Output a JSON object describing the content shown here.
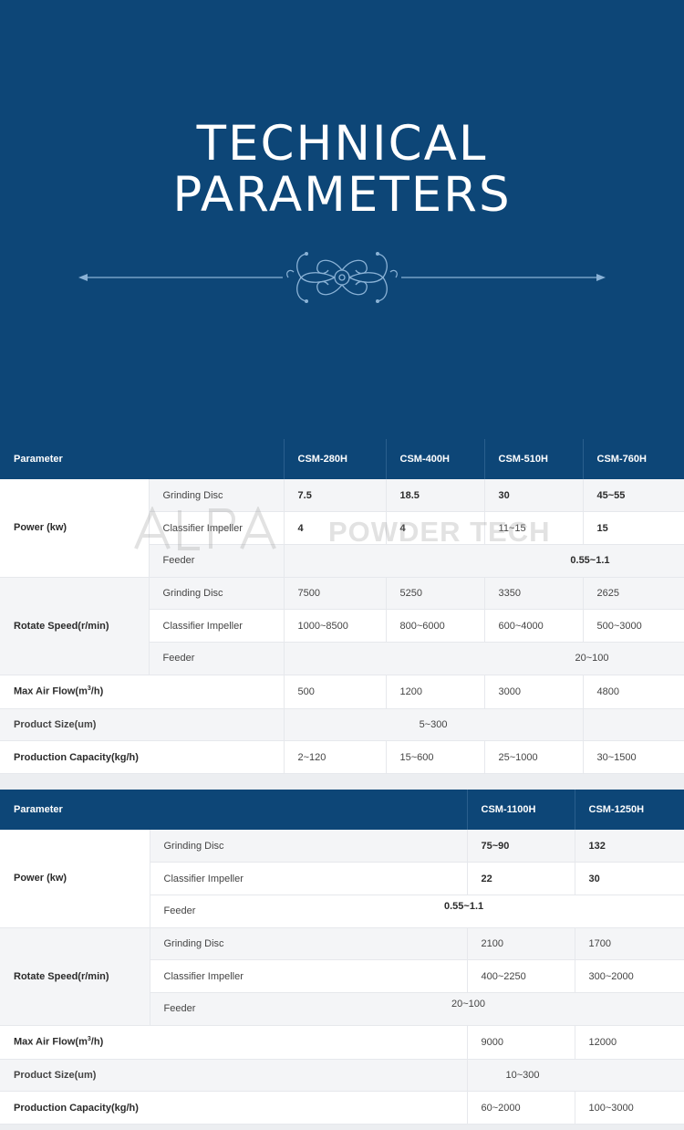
{
  "hero": {
    "title_line1": "TECHNICAL",
    "title_line2": "PARAMETERS"
  },
  "watermark": {
    "logo_text": "ALPA",
    "text": "POWDER TECH"
  },
  "table1": {
    "headers": [
      "Parameter",
      "CSM-280H",
      "CSM-400H",
      "CSM-510H",
      "CSM-760H"
    ],
    "power_label": "Power (kw)",
    "rotate_label": "Rotate Speed(r/min)",
    "sub": {
      "grinding": "Grinding Disc",
      "classifier": "Classifier Impeller",
      "feeder": "Feeder"
    },
    "power_grinding": [
      "7.5",
      "18.5",
      "30",
      "45~55"
    ],
    "power_classifier": [
      "4",
      "4",
      "11~15",
      "15"
    ],
    "power_feeder": "0.55~1.1",
    "speed_grinding": [
      "7500",
      "5250",
      "3350",
      "2625"
    ],
    "speed_classifier": [
      "1000~8500",
      "800~6000",
      "600~4000",
      "500~3000"
    ],
    "speed_feeder": "20~100",
    "airflow_label": "Max Air Flow(m",
    "airflow_sup": "3",
    "airflow_tail": "/h)",
    "airflow": [
      "500",
      "1200",
      "3000",
      "4800"
    ],
    "product_size_label": "Product Size(um)",
    "product_size": "5~300",
    "capacity_label": "Production Capacity(kg/h)",
    "capacity": [
      "2~120",
      "15~600",
      "25~1000",
      "30~1500"
    ]
  },
  "table2": {
    "headers": [
      "Parameter",
      "CSM-1100H",
      "CSM-1250H"
    ],
    "power_label": "Power (kw)",
    "rotate_label": "Rotate Speed(r/min)",
    "sub": {
      "grinding": "Grinding Disc",
      "classifier": "Classifier Impeller",
      "feeder": "Feeder"
    },
    "power_grinding": [
      "75~90",
      "132"
    ],
    "power_classifier": [
      "22",
      "30"
    ],
    "power_feeder": "0.55~1.1",
    "speed_grinding": [
      "2100",
      "1700"
    ],
    "speed_classifier": [
      "400~2250",
      "300~2000"
    ],
    "speed_feeder": "20~100",
    "airflow_label": "Max Air Flow(m",
    "airflow_sup": "3",
    "airflow_tail": "/h)",
    "airflow": [
      "9000",
      "12000"
    ],
    "product_size_label": "Product Size(um)",
    "product_size": "10~300",
    "capacity_label": "Production Capacity(kg/h)",
    "capacity": [
      "60~2000",
      "100~3000"
    ]
  },
  "colors": {
    "brand_blue": "#0d4677",
    "ornament": "#8ab2d6"
  }
}
